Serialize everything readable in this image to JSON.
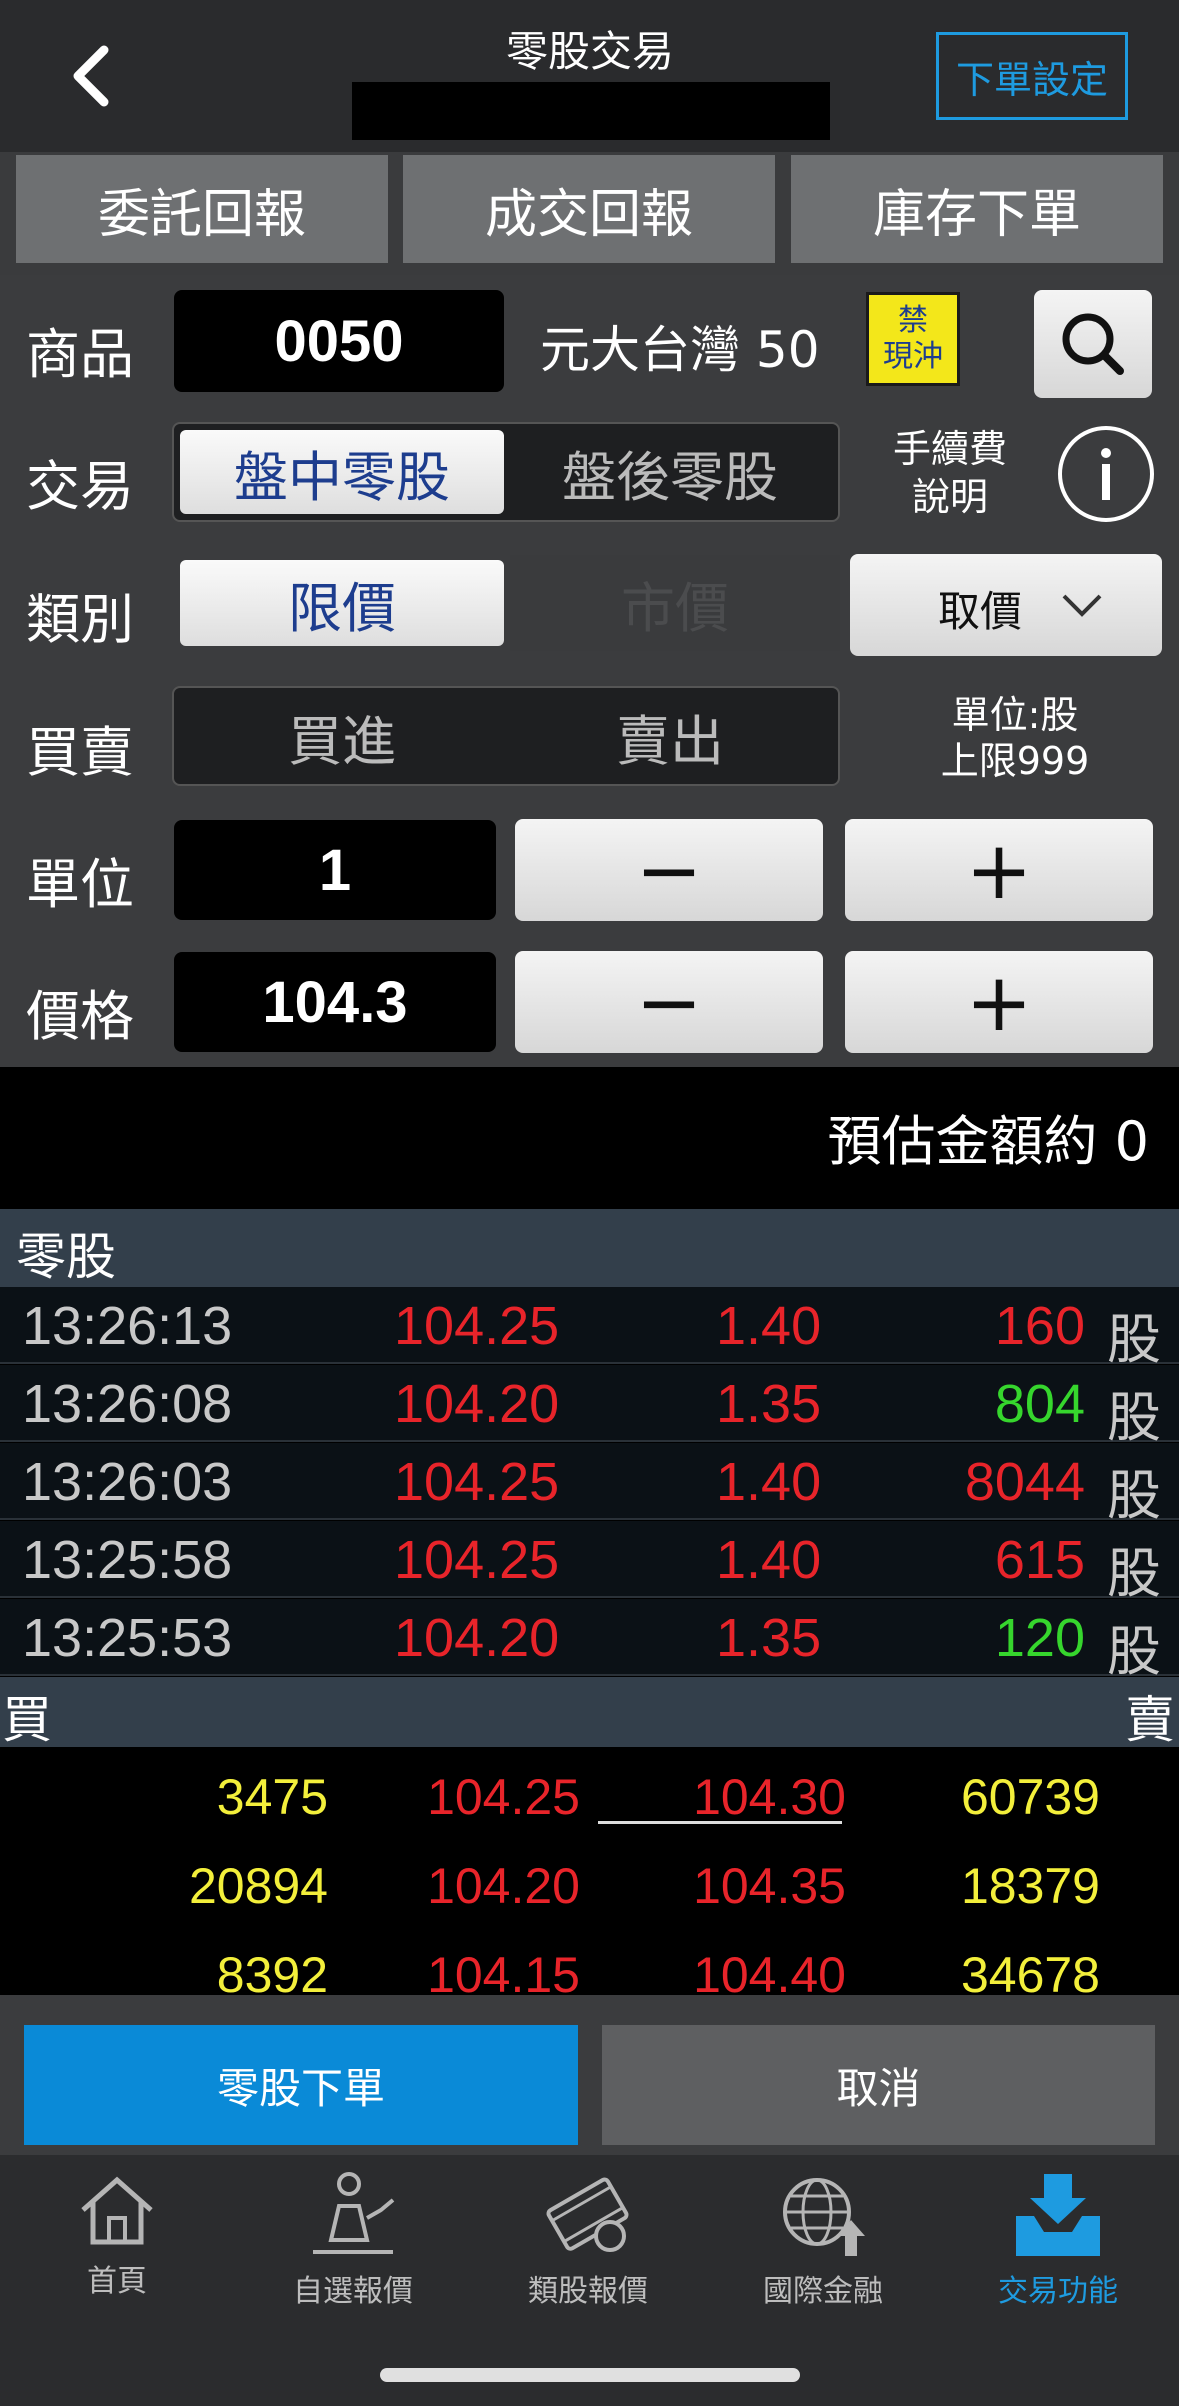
{
  "header": {
    "title": "零股交易",
    "order_setting": "下單設定"
  },
  "tabs": [
    "委託回報",
    "成交回報",
    "庫存下單"
  ],
  "form": {
    "product_label": "商品",
    "product_code": "0050",
    "product_name": "元大台灣 50",
    "no_daytrade_badge": [
      "禁",
      "現沖"
    ],
    "trade_label": "交易",
    "trade_options": [
      "盤中零股",
      "盤後零股"
    ],
    "fee_info": [
      "手續費",
      "說明"
    ],
    "type_label": "類別",
    "type_options": [
      "限價",
      "市價"
    ],
    "get_price": "取價",
    "side_label": "買賣",
    "side_options": [
      "買進",
      "賣出"
    ],
    "unit_note": [
      "單位:股",
      "上限999"
    ],
    "qty_label": "單位",
    "qty_value": "1",
    "price_label": "價格",
    "price_value": "104.3",
    "minus": "−",
    "plus": "+"
  },
  "estimate": "預估金額約 0",
  "ticks_header": "零股",
  "ticks": [
    {
      "time": "13:26:13",
      "price": "104.25",
      "change": "1.40",
      "qty": "160",
      "unit": "股",
      "qty_color": "#e8242a"
    },
    {
      "time": "13:26:08",
      "price": "104.20",
      "change": "1.35",
      "qty": "804",
      "unit": "股",
      "qty_color": "#36d62d"
    },
    {
      "time": "13:26:03",
      "price": "104.25",
      "change": "1.40",
      "qty": "8044",
      "unit": "股",
      "qty_color": "#e8242a"
    },
    {
      "time": "13:25:58",
      "price": "104.25",
      "change": "1.40",
      "qty": "615",
      "unit": "股",
      "qty_color": "#e8242a"
    },
    {
      "time": "13:25:53",
      "price": "104.20",
      "change": "1.35",
      "qty": "120",
      "unit": "股",
      "qty_color": "#36d62d"
    }
  ],
  "book_header": {
    "buy": "買",
    "sell": "賣"
  },
  "book": [
    {
      "bid_qty": "3475",
      "bid_price": "104.25",
      "ask_price": "104.30",
      "ask_qty": "60739"
    },
    {
      "bid_qty": "20894",
      "bid_price": "104.20",
      "ask_price": "104.35",
      "ask_qty": "18379"
    },
    {
      "bid_qty": "8392",
      "bid_price": "104.15",
      "ask_price": "104.40",
      "ask_qty": "34678"
    }
  ],
  "actions": {
    "place": "零股下單",
    "cancel": "取消"
  },
  "nav": [
    {
      "label": "首頁",
      "icon": "home-icon"
    },
    {
      "label": "自選報價",
      "icon": "person-chart-icon"
    },
    {
      "label": "類股報價",
      "icon": "film-coin-icon"
    },
    {
      "label": "國際金融",
      "icon": "globe-icon"
    },
    {
      "label": "交易功能",
      "icon": "download-tray-icon",
      "active": true
    }
  ],
  "colors": {
    "accent": "#0a8ad7",
    "up": "#e8242a",
    "down": "#36d62d",
    "book_qty": "#f3ef3b"
  }
}
